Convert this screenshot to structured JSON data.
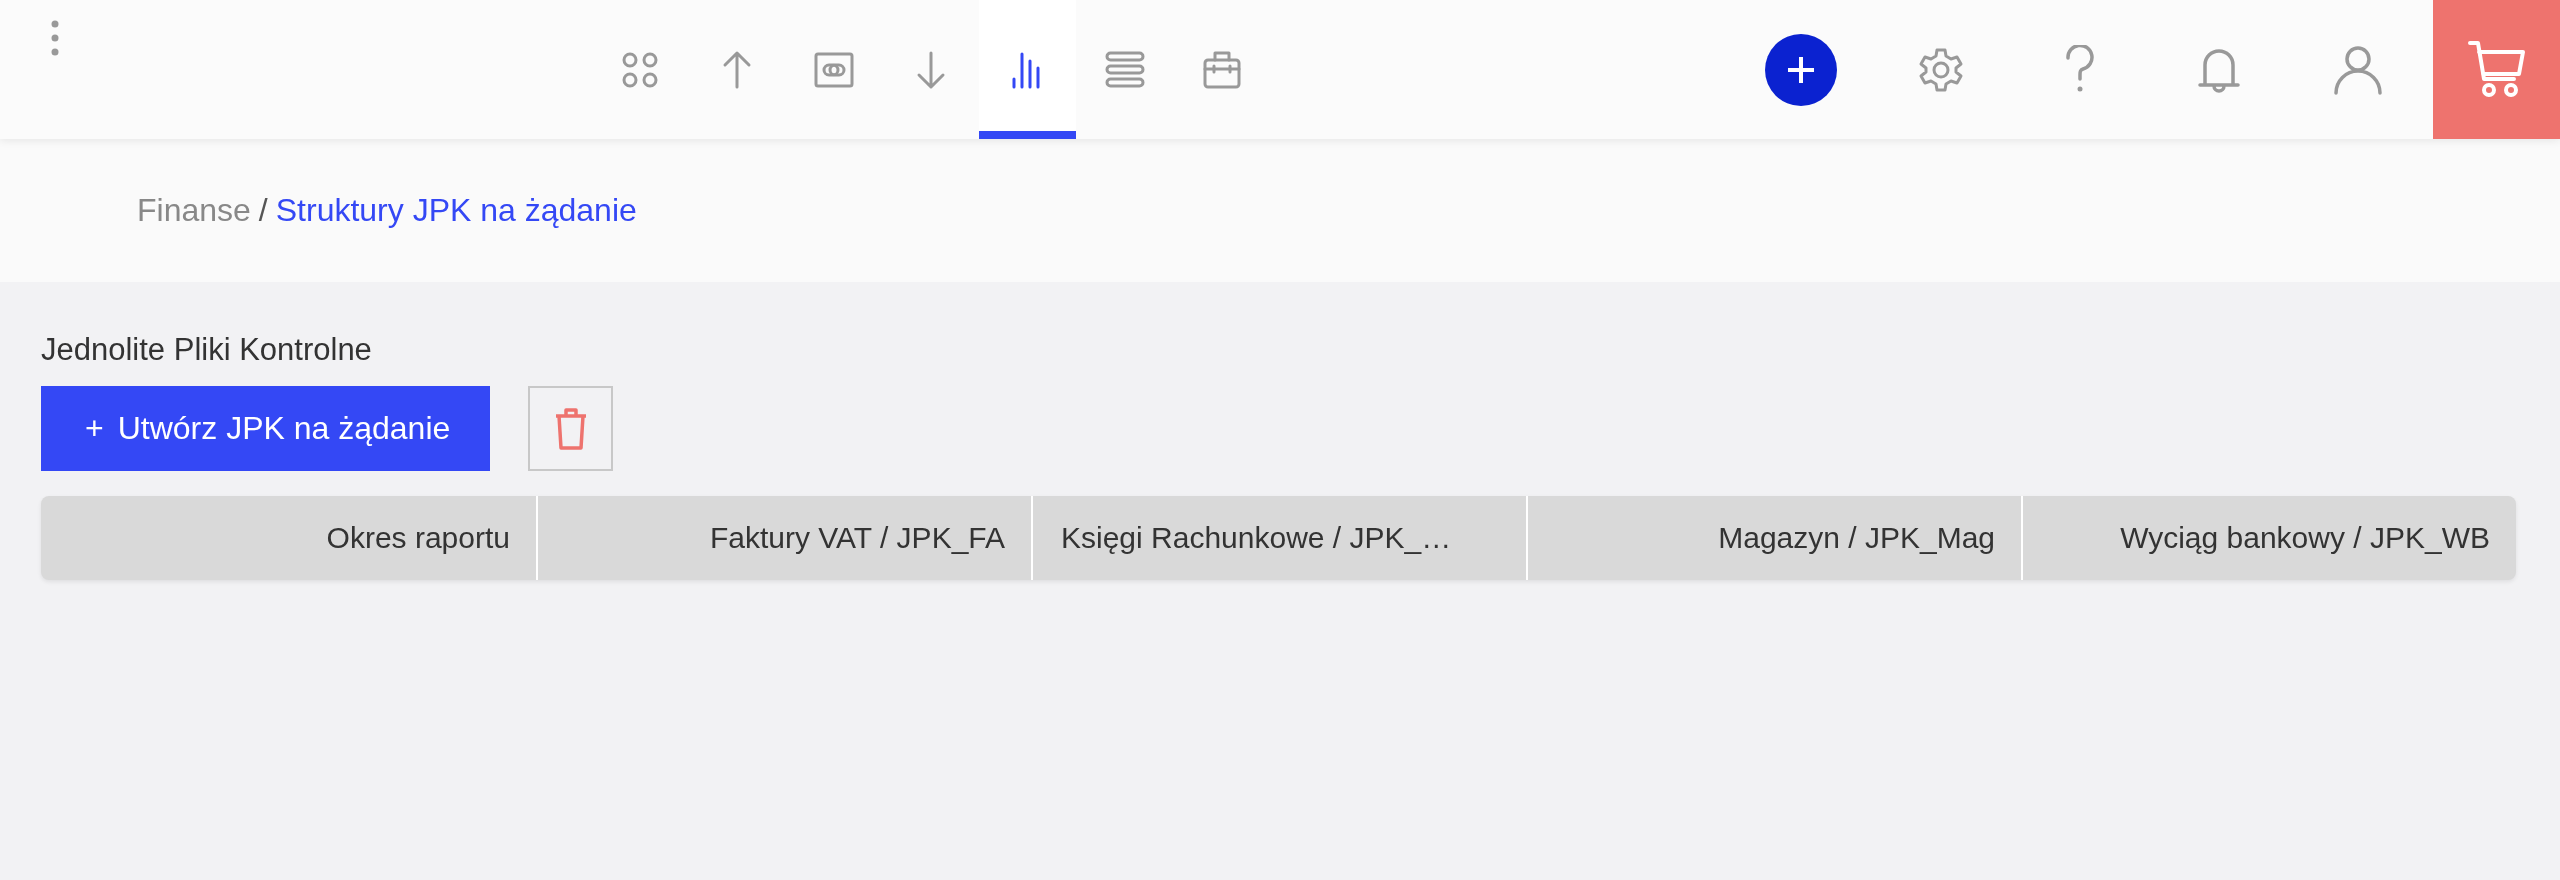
{
  "nav_tabs": [
    {
      "selected": false
    },
    {
      "selected": false
    },
    {
      "selected": false
    },
    {
      "selected": false
    },
    {
      "selected": true
    },
    {
      "selected": false
    },
    {
      "selected": false
    }
  ],
  "breadcrumb": {
    "parent": "Finanse",
    "separator": "/",
    "current": "Struktury JPK na żądanie"
  },
  "section_title": "Jednolite Pliki Kontrolne",
  "create_button": {
    "icon": "+",
    "label": "Utwórz JPK na żądanie"
  },
  "table": {
    "columns": [
      "Okres raportu",
      "Faktury VAT / JPK_FA",
      "Księgi Rachunkowe / JPK_…",
      "Magazyn / JPK_Mag",
      "Wyciąg bankowy / JPK_WB"
    ]
  }
}
